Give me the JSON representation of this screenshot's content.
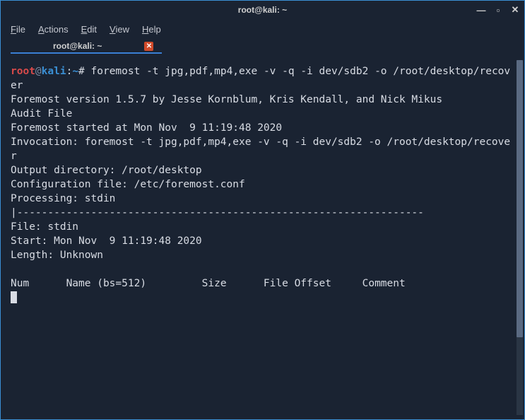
{
  "titlebar": {
    "title": "root@kali: ~",
    "min": "—",
    "max": "▫",
    "close": "✕"
  },
  "menubar": {
    "file": "File",
    "actions": "Actions",
    "edit": "Edit",
    "view": "View",
    "help": "Help"
  },
  "tab": {
    "label": "root@kali: ~",
    "close": "✕"
  },
  "prompt": {
    "user": "root",
    "at": "@",
    "host": "kali",
    "colon": ":",
    "path": "~",
    "hash": "#"
  },
  "command": " foremost -t jpg,pdf,mp4,exe -v -q -i dev/sdb2 -o /root/desktop/recover",
  "output": {
    "l1": "Foremost version 1.5.7 by Jesse Kornblum, Kris Kendall, and Nick Mikus",
    "l2": "Audit File",
    "l3": "",
    "l4": "Foremost started at Mon Nov  9 11:19:48 2020",
    "l5": "Invocation: foremost -t jpg,pdf,mp4,exe -v -q -i dev/sdb2 -o /root/desktop/recover",
    "l6": "Output directory: /root/desktop",
    "l7": "Configuration file: /etc/foremost.conf",
    "l8": "Processing: stdin",
    "l9": "|------------------------------------------------------------------",
    "l10": "File: stdin",
    "l11": "Start: Mon Nov  9 11:19:48 2020",
    "l12": "Length: Unknown",
    "l13": " ",
    "l14": "Num\t Name (bs=512) \t       Size\t File Offset\t Comment ",
    "l15": ""
  }
}
